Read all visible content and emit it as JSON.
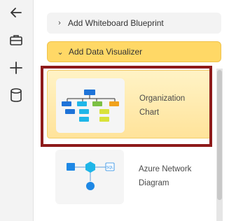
{
  "rail": {
    "icons": [
      "back-arrow-icon",
      "briefcase-icon",
      "plus-icon",
      "database-icon"
    ]
  },
  "sections": [
    {
      "label": "Add Whiteboard Blueprint",
      "expanded": false
    },
    {
      "label": "Add Data Visualizer",
      "expanded": true
    }
  ],
  "cards": [
    {
      "line1": "Organization",
      "line2": "Chart",
      "selected": true
    },
    {
      "line1": "Azure Network",
      "line2": "Diagram",
      "selected": false
    }
  ],
  "colors": {
    "accent": "#ffd866",
    "highlight_border": "#8e1a1a"
  }
}
